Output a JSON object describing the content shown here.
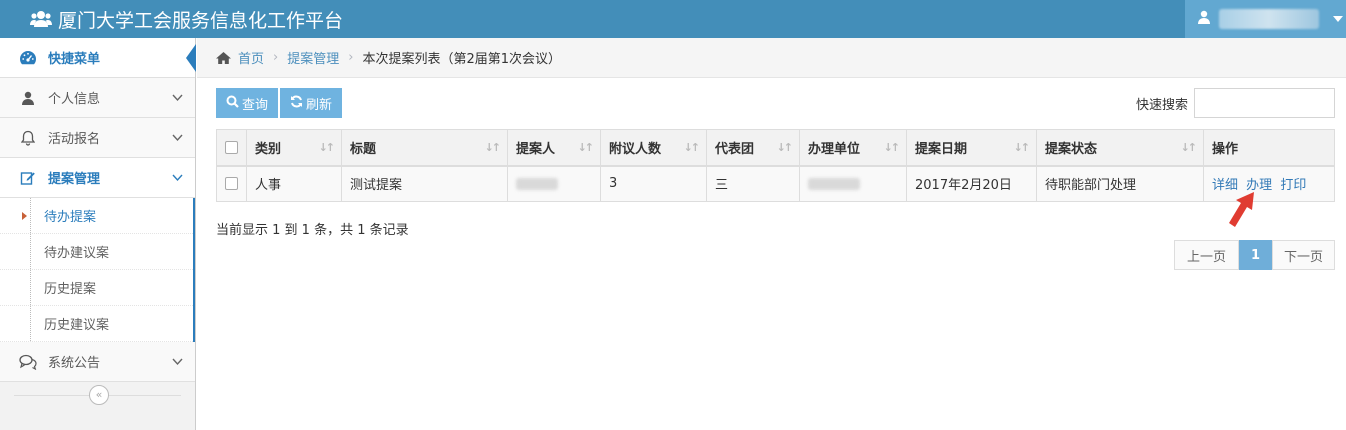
{
  "header": {
    "title": "厦门大学工会服务信息化工作平台"
  },
  "sidebar": {
    "quick_menu": "快捷菜单",
    "items": [
      {
        "label": "个人信息"
      },
      {
        "label": "活动报名"
      },
      {
        "label": "提案管理"
      }
    ],
    "sub_items": [
      {
        "label": "待办提案"
      },
      {
        "label": "待办建议案"
      },
      {
        "label": "历史提案"
      },
      {
        "label": "历史建议案"
      }
    ],
    "after_items": [
      {
        "label": "系统公告"
      }
    ],
    "collapse_glyph": "«"
  },
  "breadcrumb": {
    "home": "首页",
    "level2": "提案管理",
    "current": "本次提案列表（第2届第1次会议）",
    "sep": "›"
  },
  "toolbar": {
    "query_label": "查询",
    "refresh_label": "刷新",
    "search_label": "快速搜索",
    "search_value": ""
  },
  "table": {
    "sort_glyph": "↓↑",
    "columns": [
      "类别",
      "标题",
      "提案人",
      "附议人数",
      "代表团",
      "办理单位",
      "提案日期",
      "提案状态",
      "操作"
    ],
    "rows": [
      {
        "category": "人事",
        "title": "测试提案",
        "seconders": "3",
        "delegation": "三",
        "date": "2017年2月20日",
        "status": "待职能部门处理",
        "actions": [
          "详细",
          "办理",
          "打印"
        ]
      }
    ]
  },
  "summary": "当前显示 1 到 1 条，共 1 条记录",
  "pagination": {
    "prev": "上一页",
    "current": "1",
    "next": "下一页"
  },
  "colors": {
    "header": "#438eb9",
    "accent": "#2b7dbc",
    "button": "#6fb3e0",
    "pointer": "#e03c31"
  }
}
